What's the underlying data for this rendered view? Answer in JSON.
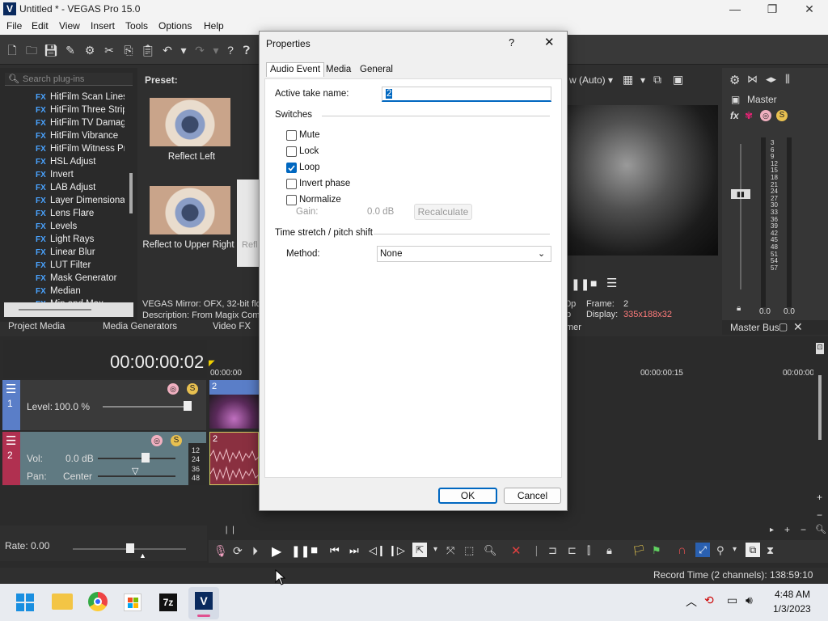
{
  "window": {
    "title": "Untitled * - VEGAS Pro 15.0",
    "app_icon": "V"
  },
  "menu": [
    "File",
    "Edit",
    "View",
    "Insert",
    "Tools",
    "Options",
    "Help"
  ],
  "plugins": {
    "search_placeholder": "Search plug-ins",
    "items": [
      "HitFilm Scan Lines",
      "HitFilm Three Strip",
      "HitFilm TV Damage",
      "HitFilm Vibrance",
      "HitFilm Witness Pr",
      "HSL Adjust",
      "Invert",
      "LAB Adjust",
      "Layer Dimensional",
      "Lens Flare",
      "Levels",
      "Light Rays",
      "Linear Blur",
      "LUT Filter",
      "Mask Generator",
      "Median",
      "Min and Max"
    ],
    "fx_badge": "FX"
  },
  "preset": {
    "label": "Preset:",
    "thumbs": [
      "Reflect Left",
      "Reflect to Upper Right"
    ],
    "thumb_partial": "Refl"
  },
  "plugin_info": {
    "line1": "VEGAS Mirror: OFX, 32-bit floa",
    "line2": "Description: From Magix Comp"
  },
  "bottom_tabs": [
    "Project Media",
    "Media Generators",
    "Video FX"
  ],
  "preview": {
    "mode": "w (Auto)",
    "frame_label": "Frame:",
    "frame_value": "2",
    "display_label": "Display:",
    "display_value": "335x188x32",
    "left_text1": "0p",
    "left_text2": "p",
    "partial_tab": "mer"
  },
  "masterbus": {
    "label": "Master",
    "tab": "Master Bus",
    "scale": [
      "3",
      "6",
      "9",
      "12",
      "15",
      "18",
      "21",
      "24",
      "27",
      "30",
      "33",
      "36",
      "39",
      "42",
      "45",
      "48",
      "51",
      "54",
      "57"
    ],
    "left_val": "0.0",
    "right_val": "0.0"
  },
  "timeline": {
    "timecode": "00:00:00:02",
    "ruler": [
      "00:00:00",
      "00:00:00:15",
      "00:00:00"
    ],
    "track1": {
      "num": "1",
      "level_label": "Level:",
      "level_value": "100.0 %",
      "clip_label": "2"
    },
    "track2": {
      "num": "2",
      "vol_label": "Vol:",
      "vol_value": "0.0 dB",
      "pan_label": "Pan:",
      "pan_value": "Center",
      "clip_label": "2",
      "db_marks": [
        "12",
        "24",
        "36",
        "48"
      ]
    },
    "rate": "Rate: 0.00"
  },
  "status": {
    "record_time": "Record Time (2 channels): 138:59:10"
  },
  "taskbar": {
    "time": "4:48 AM",
    "date": "1/3/2023",
    "apps": [
      "start-icon",
      "file-explorer-icon",
      "chrome-icon",
      "store-icon",
      "7zip-icon",
      "vegas-icon"
    ]
  },
  "dialog": {
    "title": "Properties",
    "help": "?",
    "close": "✕",
    "tabs": [
      "Audio Event",
      "Media",
      "General"
    ],
    "active_take_label": "Active take name:",
    "active_take_value": "2",
    "switches_label": "Switches",
    "switches": [
      {
        "label": "Mute",
        "checked": false
      },
      {
        "label": "Lock",
        "checked": false
      },
      {
        "label": "Loop",
        "checked": true
      },
      {
        "label": "Invert phase",
        "checked": false
      },
      {
        "label": "Normalize",
        "checked": false
      }
    ],
    "gain_label": "Gain:",
    "gain_value": "0.0 dB",
    "recalculate": "Recalculate",
    "stretch_label": "Time stretch / pitch shift",
    "method_label": "Method:",
    "method_value": "None",
    "ok": "OK",
    "cancel": "Cancel"
  }
}
